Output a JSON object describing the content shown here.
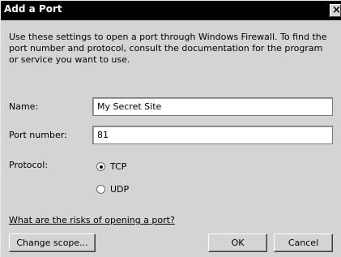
{
  "dialog": {
    "title": "Add a Port",
    "close_glyph": "✕",
    "description": "Use these settings to open a port through Windows Firewall. To find the port number and protocol, consult the documentation for the program or service you want to use."
  },
  "form": {
    "name_label": "Name:",
    "name_value": "My Secret Site",
    "port_label": "Port number:",
    "port_value": "81",
    "protocol_label": "Protocol:",
    "protocol_options": [
      {
        "label": "TCP",
        "selected": true
      },
      {
        "label": "UDP",
        "selected": false
      }
    ]
  },
  "link_text": "What are the risks of opening a port?",
  "buttons": {
    "change_scope": "Change scope...",
    "ok": "OK",
    "cancel": "Cancel"
  }
}
